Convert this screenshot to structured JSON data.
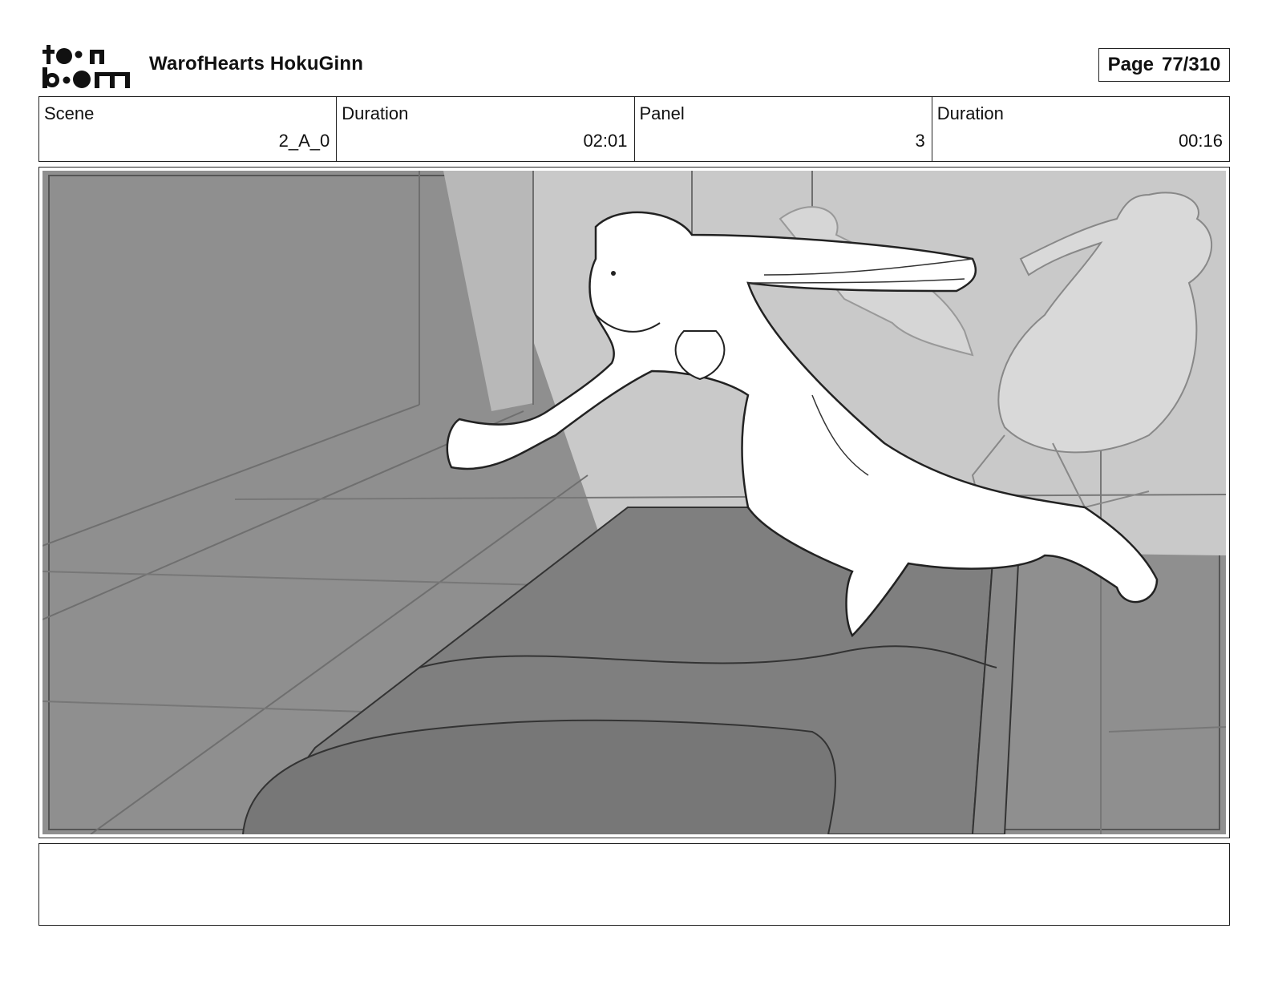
{
  "header": {
    "logo_text": "toon boom",
    "project_title": "WarofHearts HokuGinn",
    "page_label": "Page",
    "page_number": "77/310"
  },
  "info": {
    "scene_label": "Scene",
    "scene_value": "2_A_0",
    "scene_duration_label": "Duration",
    "scene_duration_value": "02:01",
    "panel_label": "Panel",
    "panel_value": "3",
    "panel_duration_label": "Duration",
    "panel_duration_value": "00:16"
  },
  "notes": {
    "text": ""
  },
  "colors": {
    "border": "#222222",
    "sketch_dark": "#7f7f7f",
    "sketch_mid": "#8f8f8f",
    "sketch_light": "#c9c9c9",
    "sketch_white": "#ffffff"
  }
}
